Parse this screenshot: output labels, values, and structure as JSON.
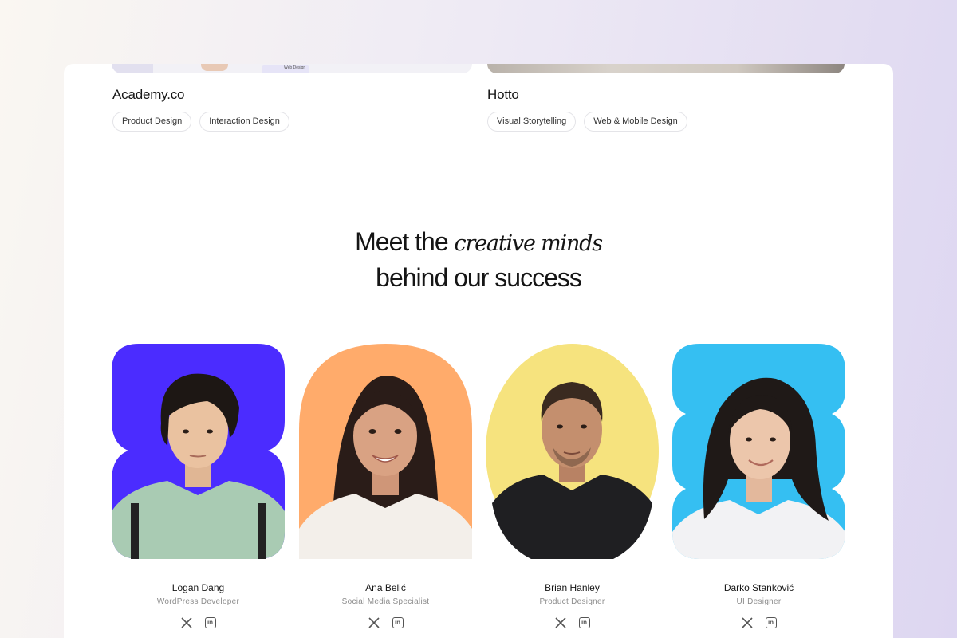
{
  "projects": [
    {
      "title": "Academy.co",
      "thumb_label": "Web Design",
      "tags": [
        "Product Design",
        "Interaction Design"
      ]
    },
    {
      "title": "Hotto",
      "tags": [
        "Visual Storytelling",
        "Web & Mobile Design"
      ]
    }
  ],
  "team_section": {
    "heading_line1_start": "Meet the ",
    "heading_line1_italic": "creative minds",
    "heading_line2": "behind our success"
  },
  "team": [
    {
      "name": "Logan Dang",
      "role": "WordPress Developer",
      "bg_color": "#4b2cff",
      "shape": "double-blob"
    },
    {
      "name": "Ana Belić",
      "role": "Social Media Specialist",
      "bg_color": "#ffab6b",
      "shape": "arch"
    },
    {
      "name": "Brian Hanley",
      "role": "Product Designer",
      "bg_color": "#f6e37e",
      "shape": "oval"
    },
    {
      "name": "Darko Stanković",
      "role": "UI Designer",
      "bg_color": "#35bff2",
      "shape": "triple-blob"
    }
  ],
  "social_icons": [
    "x-icon",
    "linkedin-icon"
  ],
  "linkedin_glyph": "in"
}
